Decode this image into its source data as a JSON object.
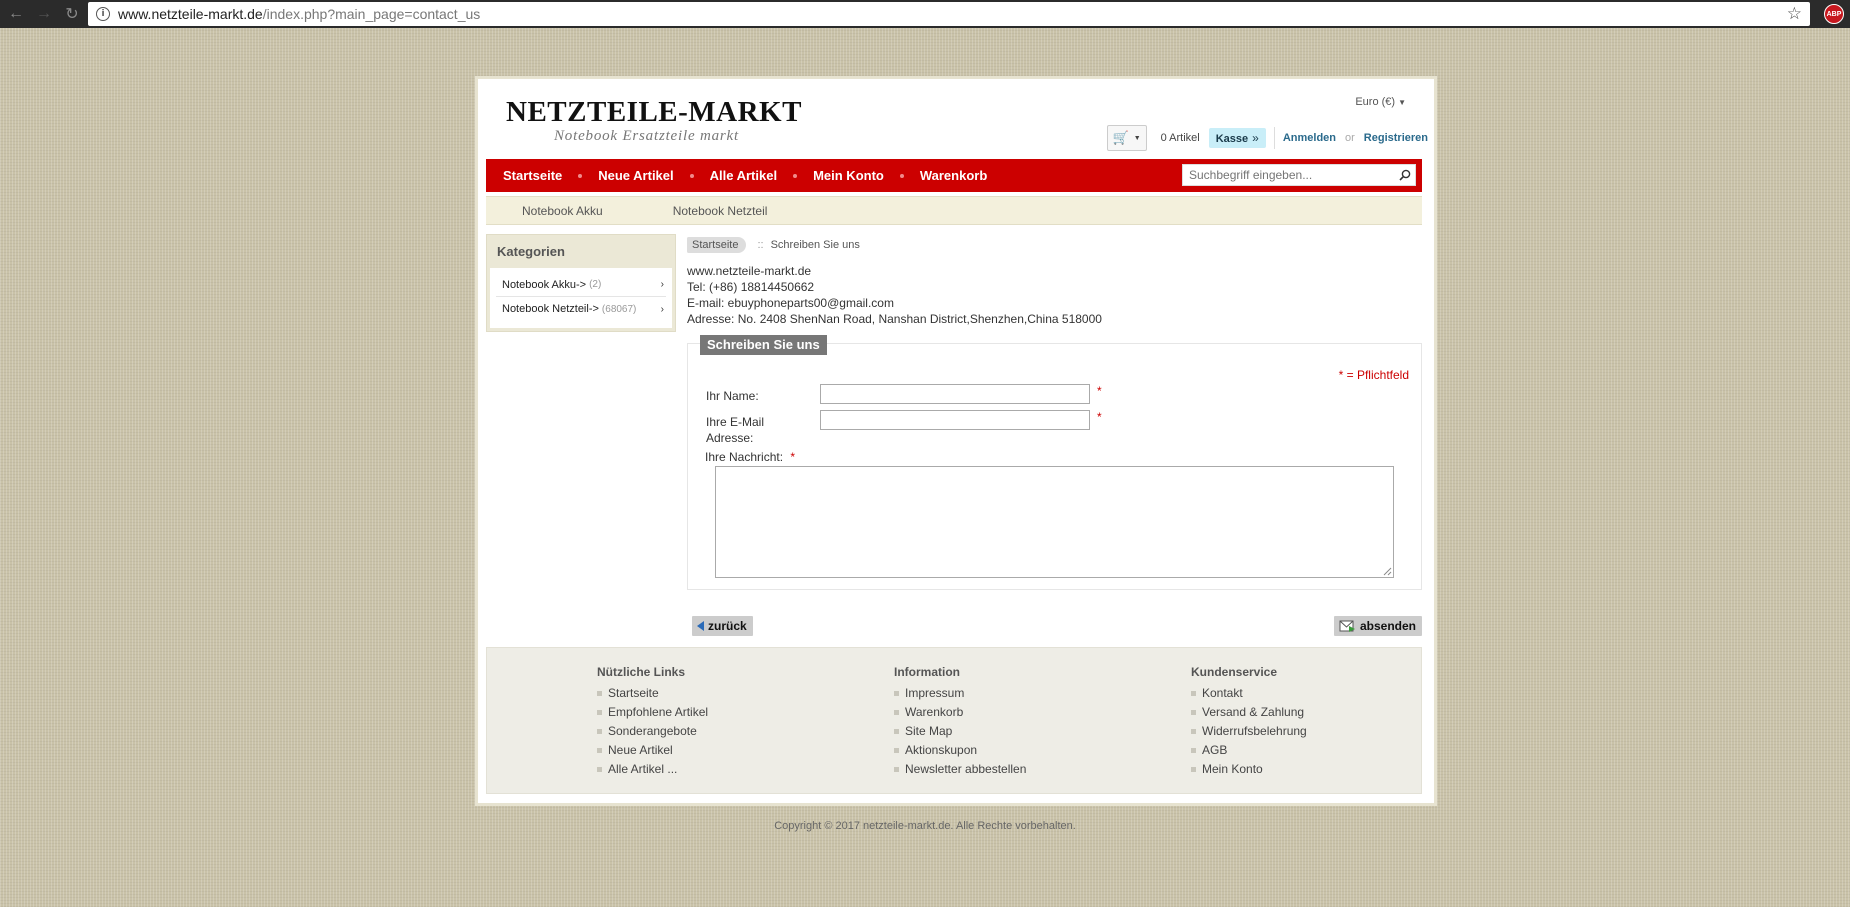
{
  "browser": {
    "url_host": "www.netzteile-markt.de",
    "url_path": "/index.php?main_page=contact_us",
    "extension_badge": "ABP"
  },
  "header": {
    "logo": "NETZTEILE-MARKT",
    "tagline": "Notebook Ersatzteile markt",
    "currency": "Euro (€)",
    "cart_count": "0 Artikel",
    "checkout": "Kasse",
    "login": "Anmelden",
    "or": "or",
    "register": "Registrieren"
  },
  "nav": {
    "items": [
      "Startseite",
      "Neue Artikel",
      "Alle Artikel",
      "Mein Konto",
      "Warenkorb"
    ],
    "search_placeholder": "Suchbegriff eingeben..."
  },
  "subnav": [
    "Notebook Akku",
    "Notebook Netzteil"
  ],
  "sidebar": {
    "title": "Kategorien",
    "items": [
      {
        "label": "Notebook Akku->",
        "count": "(2)"
      },
      {
        "label": "Notebook Netzteil->",
        "count": "(68067)"
      }
    ]
  },
  "breadcrumb": {
    "home": "Startseite",
    "separator": "::",
    "current": "Schreiben Sie uns"
  },
  "contact": {
    "lines": [
      "www.netzteile-markt.de",
      "Tel: (+86) 18814450662",
      "E-mail: ebuyphoneparts00@gmail.com",
      "Adresse: No. 2408 ShenNan Road, Nanshan District,Shenzhen,China 518000"
    ]
  },
  "form": {
    "legend": "Schreiben Sie uns",
    "required_note": "* = Pflichtfeld",
    "name_label": "Ihr Name:",
    "email_label_1": "Ihre E-Mail",
    "email_label_2": "Adresse:",
    "message_label": "Ihre Nachricht:",
    "asterisk": "*",
    "name_value": "",
    "email_value": "",
    "message_value": ""
  },
  "buttons": {
    "back": "zurück",
    "send": "absenden"
  },
  "footer": {
    "columns": [
      {
        "title": "Nützliche Links",
        "links": [
          "Startseite",
          "Empfohlene Artikel",
          "Sonderangebote",
          "Neue Artikel",
          "Alle Artikel ..."
        ]
      },
      {
        "title": "Information",
        "links": [
          "Impressum",
          "Warenkorb",
          "Site Map",
          "Aktionskupon",
          "Newsletter abbestellen"
        ]
      },
      {
        "title": "Kundenservice",
        "links": [
          "Kontakt",
          "Versand & Zahlung",
          "Widerrufsbelehrung",
          "AGB",
          "Mein Konto"
        ]
      }
    ]
  },
  "copyright": "Copyright © 2017 netzteile-markt.de. Alle Rechte vorbehalten.",
  "colors": {
    "nav_red": "#cc0000",
    "checkout_bg": "#c9eef8",
    "link_blue": "#2a6a8c",
    "required_red": "#cc0000"
  }
}
